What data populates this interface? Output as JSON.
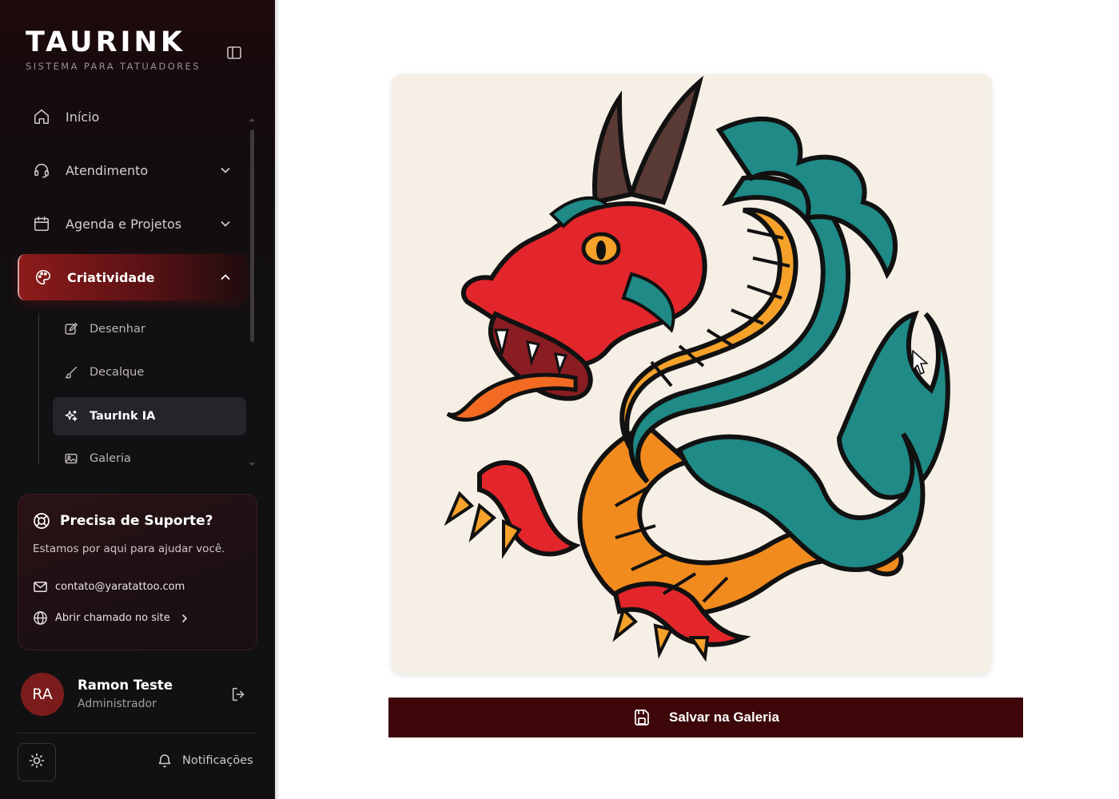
{
  "brand": {
    "title": "TAURINK",
    "subtitle": "SISTEMA PARA TATUADORES"
  },
  "nav": {
    "items": [
      {
        "label": "Início",
        "icon": "home-icon"
      },
      {
        "label": "Atendimento",
        "icon": "headset-icon"
      },
      {
        "label": "Agenda e Projetos",
        "icon": "calendar-icon"
      },
      {
        "label": "Criatividade",
        "icon": "palette-icon",
        "active": true
      }
    ],
    "sub_items": [
      {
        "label": "Desenhar",
        "icon": "edit-icon"
      },
      {
        "label": "Decalque",
        "icon": "brush-icon"
      },
      {
        "label": "TaurInk IA",
        "icon": "sparkles-icon",
        "active": true
      },
      {
        "label": "Galeria",
        "icon": "gallery-icon"
      }
    ]
  },
  "support": {
    "title": "Precisa de Suporte?",
    "description": "Estamos por aqui para ajudar você.",
    "email": "contato@yaratattoo.com",
    "ticket_label": "Abrir chamado no site"
  },
  "user": {
    "initials": "RA",
    "name": "Ramon Teste",
    "role": "Administrador"
  },
  "footer": {
    "notifications_label": "Notificações"
  },
  "main": {
    "save_label": "Salvar na Galeria"
  },
  "colors": {
    "accent": "#8d1b1b",
    "save_button_bg": "#3d0609",
    "image_bg": "#f6efe5"
  }
}
